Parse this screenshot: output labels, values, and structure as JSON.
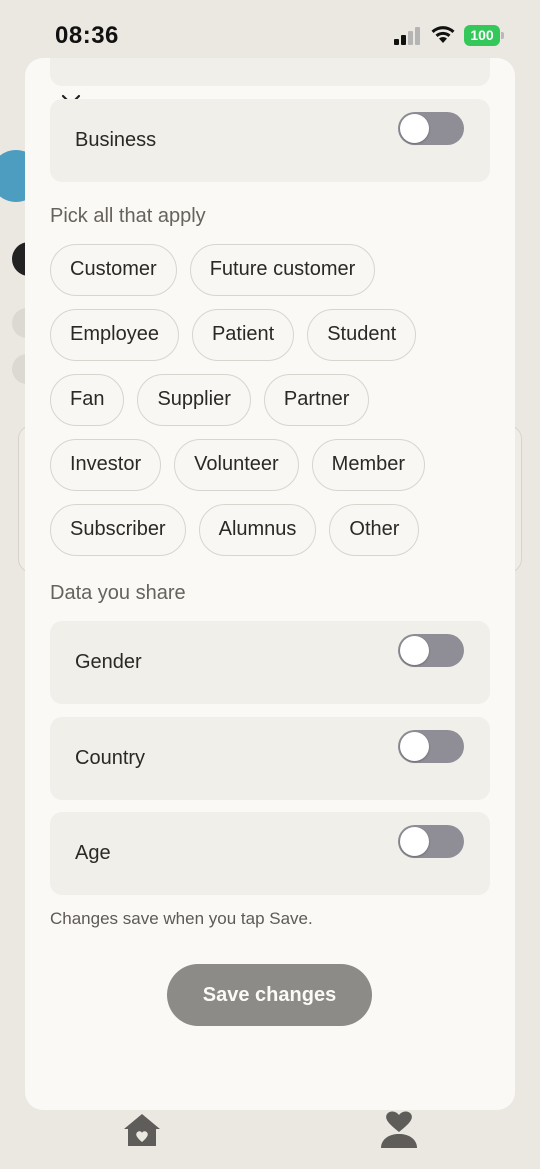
{
  "status_bar": {
    "time": "08:36",
    "battery": "100"
  },
  "sheet": {
    "business_toggle": {
      "label": "Business",
      "on": false
    },
    "relationships": {
      "title": "Pick all that apply",
      "options": [
        "Customer",
        "Future customer",
        "Employee",
        "Patient",
        "Student",
        "Fan",
        "Supplier",
        "Partner",
        "Investor",
        "Volunteer",
        "Member",
        "Subscriber",
        "Alumnus",
        "Other"
      ]
    },
    "data_share": {
      "title": "Data you share",
      "toggles": [
        {
          "label": "Gender",
          "on": false
        },
        {
          "label": "Country",
          "on": false
        },
        {
          "label": "Age",
          "on": false
        }
      ]
    },
    "hint": "Changes save when you tap Save.",
    "save_label": "Save changes"
  },
  "icons": [
    "close-icon",
    "home-heart-icon",
    "person-heart-icon",
    "wifi-icon",
    "signal-icon",
    "battery-icon"
  ],
  "colors": {
    "toggle_off": "#8f8e97",
    "battery": "#34c759",
    "save_button": "#8d8b88",
    "sheet_bg": "#faf9f5",
    "card_bg": "#f1efea"
  }
}
